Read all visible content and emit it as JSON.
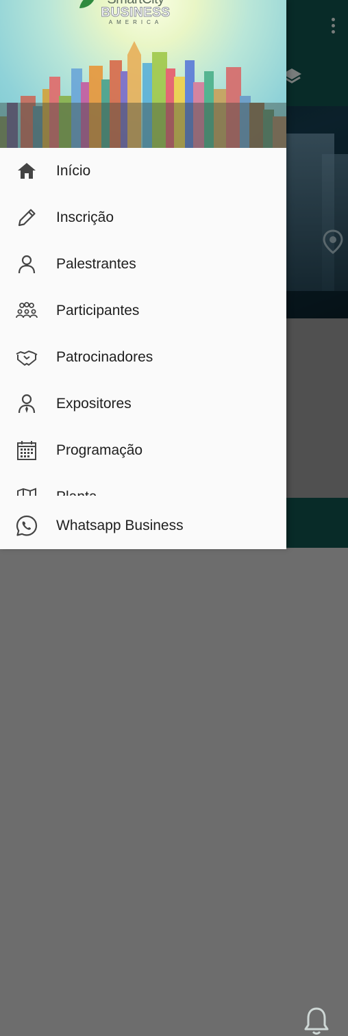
{
  "drawer": {
    "logo": {
      "line1": "SmartCity",
      "line2": "BUSINESS",
      "line3": "AMERICA"
    },
    "menu_items": [
      {
        "label": "Início",
        "icon": "home-icon"
      },
      {
        "label": "Inscrição",
        "icon": "pencil-icon"
      },
      {
        "label": "Palestrantes",
        "icon": "person-icon"
      },
      {
        "label": "Participantes",
        "icon": "group-icon"
      },
      {
        "label": "Patrocinadores",
        "icon": "handshake-icon"
      },
      {
        "label": "Expositores",
        "icon": "person-tie-icon"
      },
      {
        "label": "Programação",
        "icon": "calendar-icon"
      },
      {
        "label": "Planta",
        "icon": "map-icon"
      }
    ],
    "footer_item": {
      "label": "Whatsapp Business",
      "icon": "whatsapp-icon"
    }
  },
  "background": {
    "icons": [
      "more-vert-icon",
      "layers-icon",
      "location-pin-icon",
      "bell-icon"
    ]
  },
  "colors": {
    "app_bar": "#0f4a45",
    "drawer_bg": "#fafafa",
    "icon": "#444444",
    "text": "#202020"
  }
}
